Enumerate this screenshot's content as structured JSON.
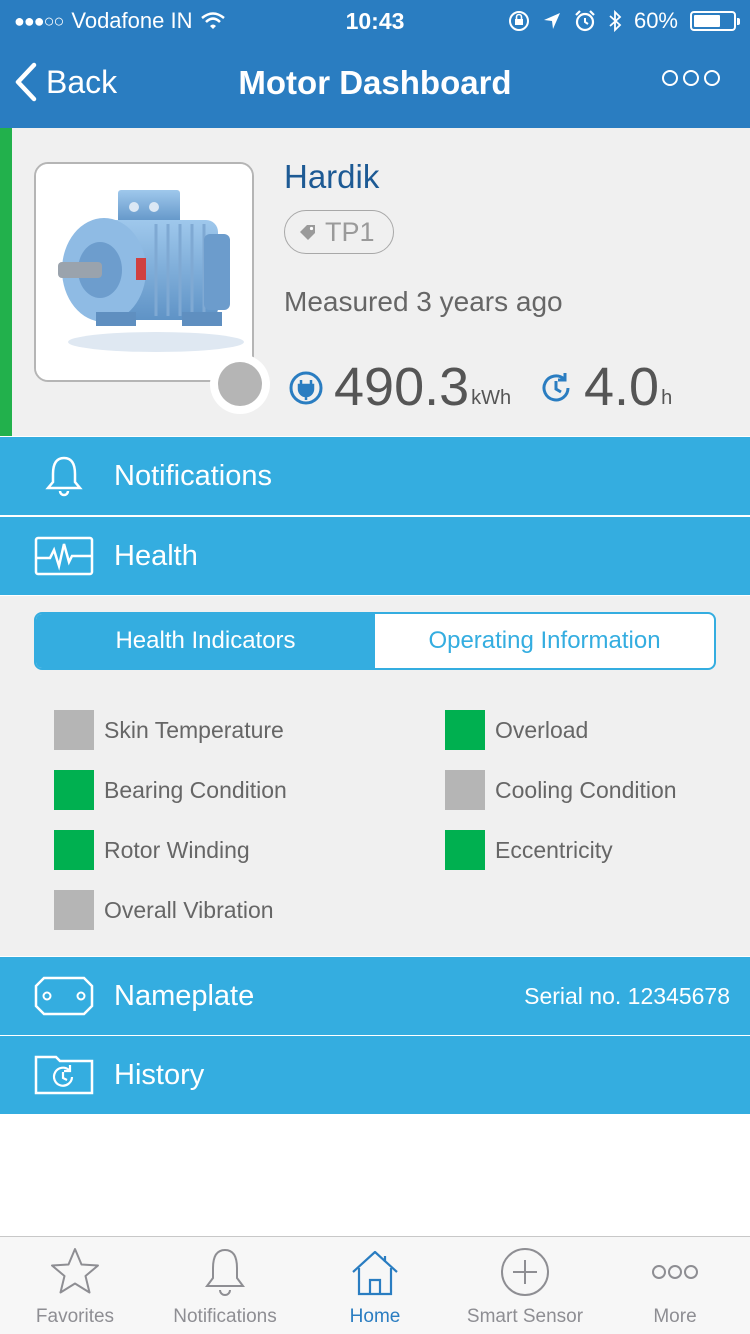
{
  "status_bar": {
    "carrier": "Vodafone IN",
    "time": "10:43",
    "battery": "60%",
    "battery_level": 0.6
  },
  "nav": {
    "back_label": "Back",
    "title": "Motor Dashboard"
  },
  "motor": {
    "name": "Hardik",
    "tag": "TP1",
    "measured": "Measured 3 years ago",
    "energy_value": "490.3",
    "energy_unit": "kWh",
    "hours_value": "4.0",
    "hours_unit": "h",
    "status_color": "#b5b5b5",
    "accent_color": "#22b14c"
  },
  "sections": {
    "notifications": "Notifications",
    "health": "Health",
    "nameplate": "Nameplate",
    "serial": "Serial no. 12345678",
    "history": "History"
  },
  "health": {
    "tabs": [
      "Health Indicators",
      "Operating Information"
    ],
    "active_tab": 0,
    "indicators": [
      {
        "label": "Skin Temperature",
        "status": "grey"
      },
      {
        "label": "Overload",
        "status": "green"
      },
      {
        "label": "Bearing Condition",
        "status": "green"
      },
      {
        "label": "Cooling Condition",
        "status": "grey"
      },
      {
        "label": "Rotor Winding",
        "status": "green"
      },
      {
        "label": "Eccentricity",
        "status": "green"
      },
      {
        "label": "Overall Vibration",
        "status": "grey"
      }
    ]
  },
  "tabbar": {
    "items": [
      {
        "label": "Favorites",
        "icon": "star-icon"
      },
      {
        "label": "Notifications",
        "icon": "bell-icon"
      },
      {
        "label": "Home",
        "icon": "home-icon"
      },
      {
        "label": "Smart Sensor",
        "icon": "plus-circle-icon"
      },
      {
        "label": "More",
        "icon": "more-icon"
      }
    ],
    "active": 2
  },
  "colors": {
    "nav_blue": "#2a7dc1",
    "section_blue": "#34ade0",
    "ok_green": "#00b050",
    "inactive_grey": "#b5b5b5"
  }
}
